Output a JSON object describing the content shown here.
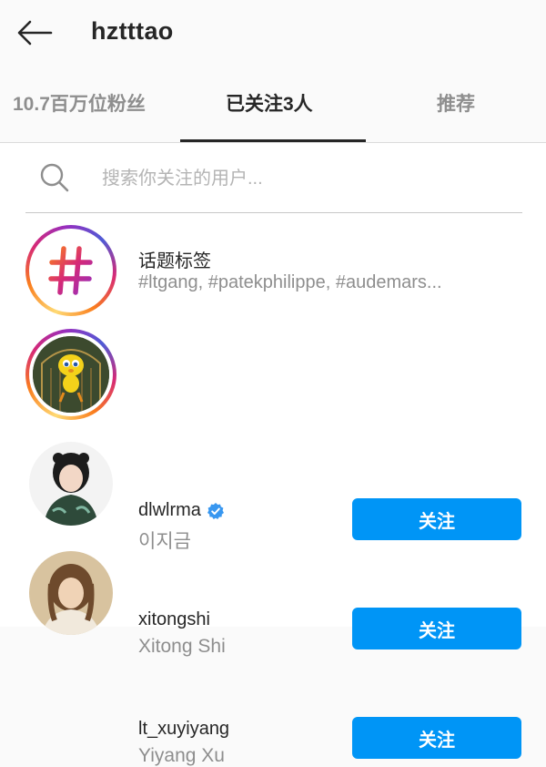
{
  "header": {
    "title": "hztttao",
    "back_icon": "arrow-left-icon"
  },
  "tabs": [
    {
      "label": "10.7百万位粉丝",
      "active": false
    },
    {
      "label": "已关注3人",
      "active": true
    },
    {
      "label": "推荐",
      "active": false
    }
  ],
  "search": {
    "placeholder": "搜索你关注的用户..."
  },
  "hashtag_row": {
    "title": "话题标签",
    "tags": "#ltgang, #patekphilippe, #audemars..."
  },
  "following": [
    {
      "username": "dlwlrma",
      "verified": true,
      "display_name": "이지금",
      "button": "关注"
    },
    {
      "username": "xitongshi",
      "verified": false,
      "display_name": "Xitong Shi",
      "button": "关注"
    },
    {
      "username": "lt_xuyiyang",
      "verified": false,
      "display_name": "Yiyang Xu",
      "button": "关注"
    }
  ],
  "colors": {
    "accent": "#0095f6",
    "text_primary": "#262626",
    "text_secondary": "#8e8e8e"
  }
}
